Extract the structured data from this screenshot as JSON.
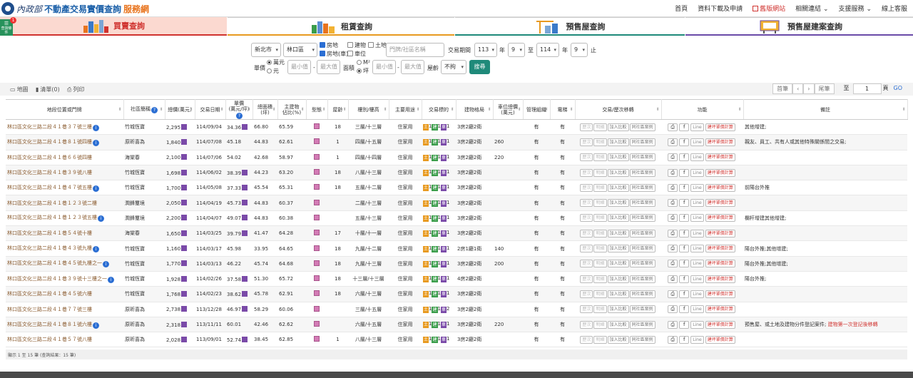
{
  "header": {
    "logo_mark": "內政部",
    "title_part1": "不動產交易實價查詢",
    "title_part2": "服務網",
    "nav": [
      "首頁",
      "資料下載及申請",
      "舊版網站",
      "相關連結",
      "支援服務",
      "線上客服"
    ]
  },
  "side_button": {
    "label": "查詢條件",
    "badge": "1"
  },
  "tabs": [
    "買賣查詢",
    "租賃查詢",
    "預售屋查詢",
    "預售屋建案查詢"
  ],
  "filters": {
    "city": "新北市",
    "district": "林口區",
    "types": [
      {
        "label": "房地",
        "checked": true
      },
      {
        "label": "房地(車)",
        "checked": true
      },
      {
        "label": "建物",
        "checked": false
      },
      {
        "label": "車位",
        "checked": false
      },
      {
        "label": "土地",
        "checked": false
      }
    ],
    "address_placeholder": "門牌/社區名稱",
    "period_label": "交易期間",
    "start_year": "113",
    "start_month": "9",
    "end_year": "114",
    "end_month": "9",
    "year_unit": "年",
    "to_label": "至",
    "end_unit": "止",
    "unit_price_label": "單價",
    "unit_price_options": [
      {
        "label": "萬元",
        "selected": true
      },
      {
        "label": "元",
        "selected": false
      }
    ],
    "area_label": "面積",
    "area_options": [
      {
        "label": "M²",
        "selected": false
      },
      {
        "label": "坪",
        "selected": true
      }
    ],
    "min_placeholder": "最小值",
    "max_placeholder": "最大值",
    "dash": "-",
    "age_label": "屋齡",
    "age_value": "不拘",
    "search_label": "搜尋"
  },
  "toolbar": {
    "map": "地圖",
    "list": "清單(0)",
    "print": "列印",
    "pager": [
      "首筆",
      "‹",
      "›",
      "尾筆"
    ],
    "goto_label": "至",
    "page_value": "1",
    "page_unit": "頁",
    "go_label": "GO"
  },
  "table": {
    "headers": [
      "地段位置或門牌",
      "社區簡稱",
      "總價(萬元)",
      "交易日期",
      "單價\n(萬元/坪)",
      "總面積\n(坪)",
      "主建物\n佔比(%)",
      "型態",
      "屋齡",
      "樓別/樓高",
      "主要用途",
      "交易標的",
      "建物格局",
      "車位總價\n(萬元)",
      "管理組織",
      "電梯",
      "交易/歷次移轉",
      "功能",
      "備註"
    ],
    "row_buttons": [
      "歷次",
      "明細",
      "加入比較",
      "同社區案例"
    ],
    "func_buttons": [
      "Line",
      "建坪單價計算"
    ],
    "rows": [
      {
        "addr": "林口區文化三路二段４１巷３７號三樓",
        "info": true,
        "community": "竹城恆寶",
        "price": "2,295",
        "date": "114/09/04",
        "unit": "34.36",
        "unit_info": true,
        "area": "66.80",
        "ratio": "65.59",
        "age": "18",
        "floor": "三層/十三層",
        "use": "住家用",
        "target": [
          "1",
          "1",
          "1"
        ],
        "layout": "3房2廳2衛",
        "parking": "",
        "mgmt": "有",
        "elevator": "有",
        "note": "其他增建;",
        "note_red": ""
      },
      {
        "addr": "林口區文化三路二段４１巷８１號四樓",
        "info": true,
        "community": "原昕喜為",
        "price": "1,840",
        "date": "114/07/08",
        "unit": "45.18",
        "unit_info": false,
        "area": "44.83",
        "ratio": "62.61",
        "age": "1",
        "floor": "四層/十五層",
        "use": "住家用",
        "target": [
          "1",
          "1",
          "1"
        ],
        "layout": "3房2廳2衛",
        "parking": "260",
        "mgmt": "有",
        "elevator": "有",
        "note": "親友、員工、共有人或其他特殊關係間之交易;",
        "note_red": ""
      },
      {
        "addr": "林口區文化三路二段４１巷６６號四樓",
        "info": false,
        "community": "海棠春",
        "price": "2,100",
        "date": "114/07/06",
        "unit": "54.02",
        "unit_info": false,
        "area": "42.68",
        "ratio": "58.97",
        "age": "1",
        "floor": "四層/十四層",
        "use": "住家用",
        "target": [
          "1",
          "1",
          "1"
        ],
        "layout": "3房2廳2衛",
        "parking": "220",
        "mgmt": "有",
        "elevator": "有",
        "note": "",
        "note_red": ""
      },
      {
        "addr": "林口區文化三路二段４１巷３９號八樓",
        "info": false,
        "community": "竹城恆寶",
        "price": "1,698",
        "date": "114/06/02",
        "unit": "38.39",
        "unit_info": true,
        "area": "44.23",
        "ratio": "63.20",
        "age": "18",
        "floor": "八層/十三層",
        "use": "住家用",
        "target": [
          "1",
          "1",
          "1"
        ],
        "layout": "3房2廳2衛",
        "parking": "",
        "mgmt": "有",
        "elevator": "有",
        "note": "",
        "note_red": ""
      },
      {
        "addr": "林口區文化三路二段４１巷４７號五樓",
        "info": true,
        "community": "竹城恆寶",
        "price": "1,700",
        "date": "114/05/08",
        "unit": "37.33",
        "unit_info": true,
        "area": "45.54",
        "ratio": "65.31",
        "age": "18",
        "floor": "五層/十二層",
        "use": "住家用",
        "target": [
          "1",
          "1",
          "1"
        ],
        "layout": "3房2廳2衛",
        "parking": "",
        "mgmt": "有",
        "elevator": "有",
        "note": "前陽台外推",
        "note_red": ""
      },
      {
        "addr": "林口區文化三路二段４１巷１２３號二樓",
        "info": false,
        "community": "潤鋒璽境",
        "price": "2,050",
        "date": "114/04/19",
        "unit": "45.73",
        "unit_info": true,
        "area": "44.83",
        "ratio": "60.37",
        "age": "",
        "floor": "二層/十三層",
        "use": "住家用",
        "target": [
          "1",
          "1",
          "1"
        ],
        "layout": "3房2廳2衛",
        "parking": "",
        "mgmt": "有",
        "elevator": "有",
        "note": "",
        "note_red": ""
      },
      {
        "addr": "林口區文化三路二段４１巷１２３號五樓",
        "info": true,
        "community": "潤鋒璽境",
        "price": "2,200",
        "date": "114/04/07",
        "unit": "49.07",
        "unit_info": true,
        "area": "44.83",
        "ratio": "60.38",
        "age": "",
        "floor": "五層/十三層",
        "use": "住家用",
        "target": [
          "1",
          "1",
          "1"
        ],
        "layout": "3房2廳2衛",
        "parking": "",
        "mgmt": "有",
        "elevator": "有",
        "note": "欄杆增建其他增建;",
        "note_red": ""
      },
      {
        "addr": "林口區文化三路二段４１巷５４號十樓",
        "info": false,
        "community": "海棠春",
        "price": "1,650",
        "date": "114/03/25",
        "unit": "39.79",
        "unit_info": true,
        "area": "41.47",
        "ratio": "64.28",
        "age": "17",
        "floor": "十層/十一層",
        "use": "住家用",
        "target": [
          "1",
          "1",
          "1"
        ],
        "layout": "3房2廳2衛",
        "parking": "",
        "mgmt": "有",
        "elevator": "有",
        "note": "",
        "note_red": ""
      },
      {
        "addr": "林口區文化三路二段４１巷４３號九樓",
        "info": true,
        "community": "竹城恆寶",
        "price": "1,160",
        "date": "114/03/17",
        "unit": "45.98",
        "unit_info": false,
        "area": "33.95",
        "ratio": "64.65",
        "age": "18",
        "floor": "九層/十二層",
        "use": "住家用",
        "target": [
          "1",
          "1",
          "1"
        ],
        "layout": "2房1廳1衛",
        "parking": "140",
        "mgmt": "有",
        "elevator": "有",
        "note": "陽台外推;其他增建;",
        "note_red": ""
      },
      {
        "addr": "林口區文化三路二段４１巷４５號九樓之一",
        "info": true,
        "community": "竹城恆寶",
        "price": "1,770",
        "date": "114/03/13",
        "unit": "46.22",
        "unit_info": false,
        "area": "45.74",
        "ratio": "64.68",
        "age": "18",
        "floor": "九層/十三層",
        "use": "住家用",
        "target": [
          "1",
          "1",
          "1"
        ],
        "layout": "3房2廳2衛",
        "parking": "200",
        "mgmt": "有",
        "elevator": "有",
        "note": "陽台外推;其他增建;",
        "note_red": ""
      },
      {
        "addr": "林口區文化三路二段４１巷３９號十三樓之一",
        "info": true,
        "community": "竹城恆寶",
        "price": "1,928",
        "date": "114/02/26",
        "unit": "37.58",
        "unit_info": true,
        "area": "51.30",
        "ratio": "65.72",
        "age": "18",
        "floor": "十三層/十三層",
        "use": "住家用",
        "target": [
          "1",
          "1",
          "1"
        ],
        "layout": "4房2廳2衛",
        "parking": "",
        "mgmt": "有",
        "elevator": "有",
        "note": "陽台外推;",
        "note_red": ""
      },
      {
        "addr": "林口區文化三路二段４１巷４５號六樓",
        "info": false,
        "community": "竹城恆寶",
        "price": "1,768",
        "date": "114/02/23",
        "unit": "38.62",
        "unit_info": true,
        "area": "45.78",
        "ratio": "62.91",
        "age": "18",
        "floor": "六層/十三層",
        "use": "住家用",
        "target": [
          "1",
          "1",
          "1"
        ],
        "layout": "3房2廳2衛",
        "parking": "",
        "mgmt": "有",
        "elevator": "有",
        "note": "",
        "note_red": ""
      },
      {
        "addr": "林口區文化三路二段４１巷７７號三樓",
        "info": false,
        "community": "原昕喜為",
        "price": "2,738",
        "date": "113/12/28",
        "unit": "46.97",
        "unit_info": true,
        "area": "58.29",
        "ratio": "60.06",
        "age": "",
        "floor": "三層/十五層",
        "use": "住家用",
        "target": [
          "1",
          "1",
          "2"
        ],
        "layout": "3房2廳2衛",
        "parking": "",
        "mgmt": "有",
        "elevator": "有",
        "note": "",
        "note_red": ""
      },
      {
        "addr": "林口區文化三路二段４１巷８１號六樓",
        "info": true,
        "community": "原昕喜為",
        "price": "2,318",
        "date": "113/11/11",
        "unit": "60.01",
        "unit_info": false,
        "area": "42.46",
        "ratio": "62.62",
        "age": "",
        "floor": "六層/十五層",
        "use": "住家用",
        "target": [
          "1",
          "1",
          "1"
        ],
        "layout": "3房2廳2衛",
        "parking": "220",
        "mgmt": "有",
        "elevator": "有",
        "note": "預售屋、或土地及建物分件登記案件; ",
        "note_red": "建物第一次登記後移轉"
      },
      {
        "addr": "林口區文化三路二段４１巷５７號八樓",
        "info": false,
        "community": "原昕喜為",
        "price": "2,028",
        "date": "113/09/01",
        "unit": "52.74",
        "unit_info": true,
        "area": "38.45",
        "ratio": "62.85",
        "age": "1",
        "floor": "八層/十三層",
        "use": "住家用",
        "target": [
          "1",
          "1",
          "1"
        ],
        "layout": "3房2廳2衛",
        "parking": "",
        "mgmt": "有",
        "elevator": "有",
        "note": "",
        "note_red": ""
      }
    ]
  },
  "footer": {
    "summary": "顯示 1 至 15 筆 (查詢結果：15 筆)"
  },
  "colors": {
    "brand_blue": "#1a5fa8",
    "brand_orange": "#e8741e",
    "search_teal": "#1f8a7a",
    "link_brown": "#8a5a2d"
  }
}
